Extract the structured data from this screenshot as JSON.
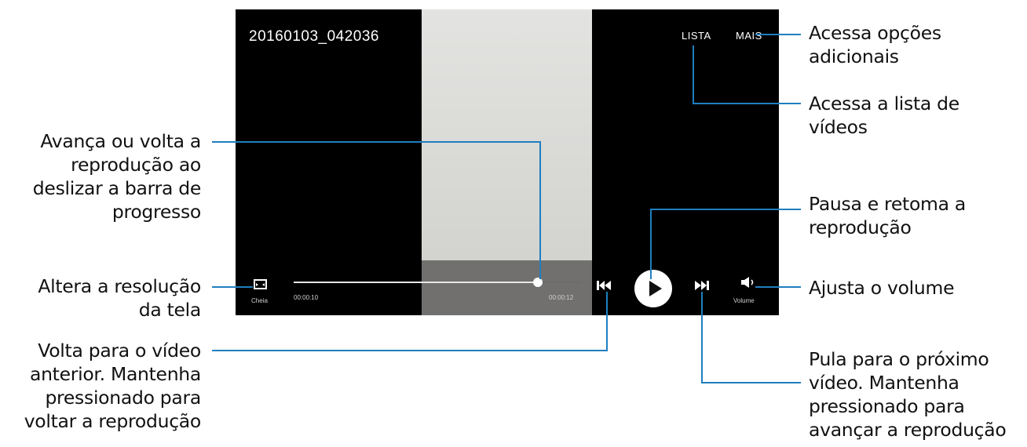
{
  "player": {
    "title": "20160103_042036",
    "list_button": "LISTA",
    "more_button": "MAIS",
    "resolution_label": "Cheia",
    "current_time": "00:00:10",
    "total_time": "00:00:12",
    "progress_fraction": 0.85,
    "volume_label": "Volume",
    "accent_color": "#ffffff"
  },
  "icons": {
    "resolution": "fullscreen-icon",
    "previous": "skip-back-icon",
    "play": "play-icon",
    "next": "skip-forward-icon",
    "volume": "volume-icon"
  },
  "annotations": {
    "more": "Acessa opções\nadicionais",
    "list": "Acessa a lista de\nvídeos",
    "progress": "Avança ou volta a\nreprodução ao\ndeslizar a barra de\nprogresso",
    "play": "Pausa e retoma a\nreprodução",
    "resolution": "Altera a resolução\nda tela",
    "volume": "Ajusta o volume",
    "previous": "Volta para o vídeo\nanterior. Mantenha\npressionado para\nvoltar a reprodução",
    "next": "Pula para o próximo\nvídeo. Mantenha\npressionado para\navançar a reprodução"
  },
  "leader_color": "#1f7fbf"
}
